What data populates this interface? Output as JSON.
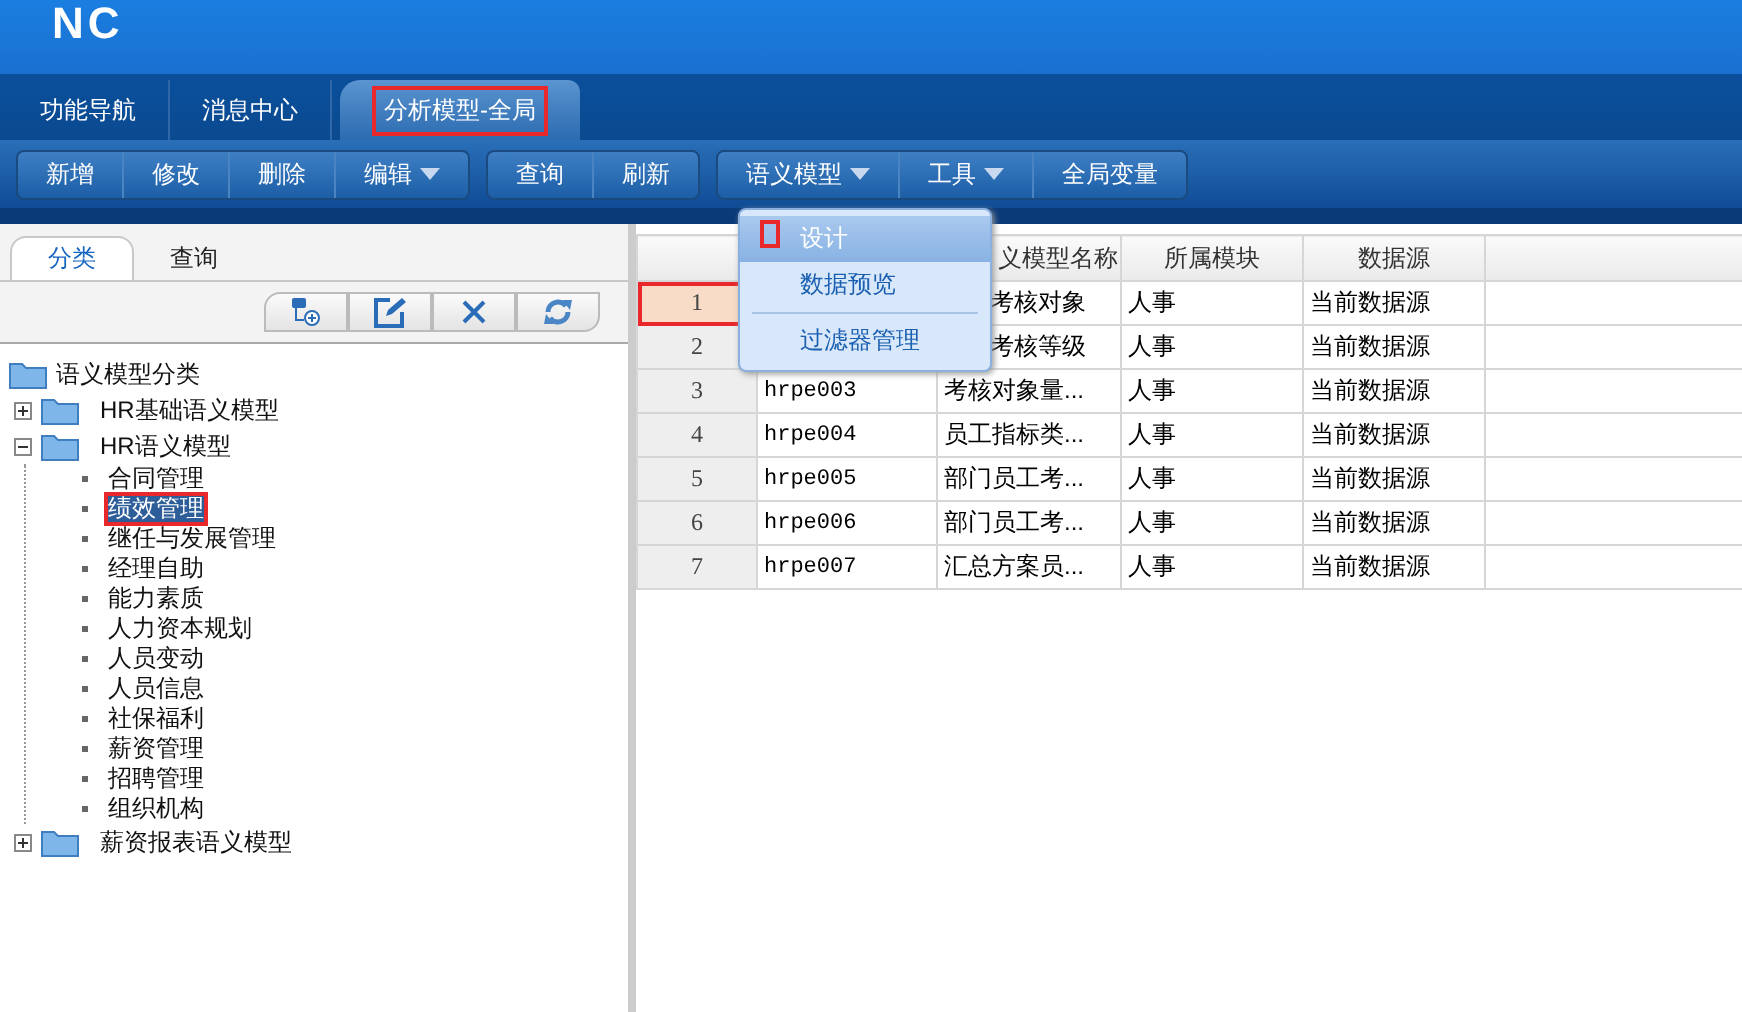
{
  "logo": {
    "text": "NC"
  },
  "tabs": [
    {
      "label": "功能导航",
      "selected": false,
      "highlighted": false
    },
    {
      "label": "消息中心",
      "selected": false,
      "highlighted": false
    },
    {
      "label": "分析模型-全局",
      "selected": true,
      "highlighted": true
    }
  ],
  "toolbar": {
    "groups": [
      [
        {
          "label": "新增",
          "dropdown": false
        },
        {
          "label": "修改",
          "dropdown": false
        },
        {
          "label": "删除",
          "dropdown": false
        },
        {
          "label": "编辑",
          "dropdown": true
        }
      ],
      [
        {
          "label": "查询",
          "dropdown": false
        },
        {
          "label": "刷新",
          "dropdown": false
        }
      ],
      [
        {
          "label": "语义模型",
          "dropdown": true
        },
        {
          "label": "工具",
          "dropdown": true
        },
        {
          "label": "全局变量",
          "dropdown": false
        }
      ]
    ]
  },
  "left_panel": {
    "tabs": [
      {
        "label": "分类",
        "selected": true
      },
      {
        "label": "查询",
        "selected": false
      }
    ],
    "tree": [
      {
        "label": "语义模型分类",
        "kind": "root",
        "children": [
          {
            "label": "HR基础语义模型",
            "kind": "folder",
            "expanded": false
          },
          {
            "label": "HR语义模型",
            "kind": "folder",
            "expanded": true,
            "children": [
              {
                "label": "合同管理",
                "kind": "leaf",
                "selected": false,
                "highlighted": false
              },
              {
                "label": "绩效管理",
                "kind": "leaf",
                "selected": true,
                "highlighted": true
              },
              {
                "label": "继任与发展管理",
                "kind": "leaf",
                "selected": false,
                "highlighted": false
              },
              {
                "label": "经理自助",
                "kind": "leaf",
                "selected": false,
                "highlighted": false
              },
              {
                "label": "能力素质",
                "kind": "leaf",
                "selected": false,
                "highlighted": false
              },
              {
                "label": "人力资本规划",
                "kind": "leaf",
                "selected": false,
                "highlighted": false
              },
              {
                "label": "人员变动",
                "kind": "leaf",
                "selected": false,
                "highlighted": false
              },
              {
                "label": "人员信息",
                "kind": "leaf",
                "selected": false,
                "highlighted": false
              },
              {
                "label": "社保福利",
                "kind": "leaf",
                "selected": false,
                "highlighted": false
              },
              {
                "label": "薪资管理",
                "kind": "leaf",
                "selected": false,
                "highlighted": false
              },
              {
                "label": "招聘管理",
                "kind": "leaf",
                "selected": false,
                "highlighted": false
              },
              {
                "label": "组织机构",
                "kind": "leaf",
                "selected": false,
                "highlighted": false
              }
            ]
          },
          {
            "label": "薪资报表语义模型",
            "kind": "folder",
            "expanded": false
          }
        ]
      }
    ]
  },
  "table": {
    "columns": [
      {},
      {
        "header": "义模型名称"
      },
      {
        "header": "所属模块"
      },
      {
        "header": "数据源"
      },
      {}
    ],
    "rows": [
      {
        "number": "1",
        "selected": true,
        "highlighted": true,
        "cells": [
          "",
          "考核对象",
          "人事",
          "当前数据源",
          ""
        ]
      },
      {
        "number": "2",
        "selected": false,
        "highlighted": false,
        "cells": [
          "",
          "考核等级",
          "人事",
          "当前数据源",
          ""
        ]
      },
      {
        "number": "3",
        "selected": false,
        "highlighted": false,
        "cells": [
          "hrpe003",
          "考核对象量...",
          "人事",
          "当前数据源",
          ""
        ]
      },
      {
        "number": "4",
        "selected": false,
        "highlighted": false,
        "cells": [
          "hrpe004",
          "员工指标类...",
          "人事",
          "当前数据源",
          ""
        ]
      },
      {
        "number": "5",
        "selected": false,
        "highlighted": false,
        "cells": [
          "hrpe005",
          "部门员工考...",
          "人事",
          "当前数据源",
          ""
        ]
      },
      {
        "number": "6",
        "selected": false,
        "highlighted": false,
        "cells": [
          "hrpe006",
          "部门员工考...",
          "人事",
          "当前数据源",
          ""
        ]
      },
      {
        "number": "7",
        "selected": false,
        "highlighted": false,
        "cells": [
          "hrpe007",
          "汇总方案员...",
          "人事",
          "当前数据源",
          ""
        ]
      }
    ]
  },
  "context_menu": {
    "items": [
      {
        "label": "设计",
        "selected": true,
        "highlighted": true
      },
      {
        "label": "数据预览",
        "selected": false,
        "highlighted": false
      },
      {
        "label": "过滤器管理",
        "selected": false,
        "highlighted": false
      }
    ]
  }
}
